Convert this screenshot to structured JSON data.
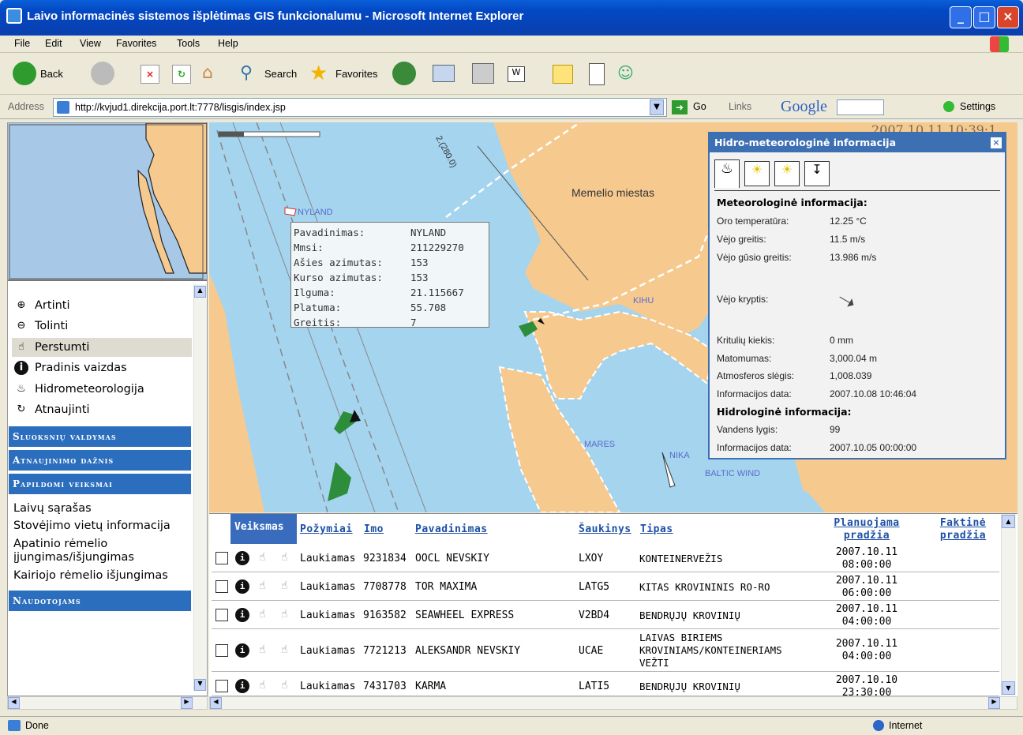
{
  "window": {
    "title": "Laivo informacinės sistemos išplėtimas GIS funkcionalumu - Microsoft Internet Explorer"
  },
  "menu": [
    "File",
    "Edit",
    "View",
    "Favorites",
    "Tools",
    "Help"
  ],
  "toolbar": {
    "back": "Back",
    "search": "Search",
    "favorites": "Favorites"
  },
  "address": {
    "label": "Address",
    "url": "http://kvjud1.direkcija.port.lt:7778/lisgis/index.jsp",
    "go": "Go",
    "links": "Links",
    "google": "Google",
    "settings": "Settings"
  },
  "tools": [
    {
      "label": "Artinti",
      "icon": "zoom-in-icon"
    },
    {
      "label": "Tolinti",
      "icon": "zoom-out-icon"
    },
    {
      "label": "Perstumti",
      "icon": "pan-hand-icon"
    },
    {
      "label": "Pradinis vaizdas",
      "icon": "info-icon"
    },
    {
      "label": "Hidrometeorologija",
      "icon": "hydro-icon"
    },
    {
      "label": "Atnaujinti",
      "icon": "refresh-icon"
    }
  ],
  "sections": {
    "layers": "Sluoksnių valdymas",
    "refresh_rate": "Atnaujinimo dažnis",
    "extra": "Papildomi veiksmai",
    "users": "Naudotojams"
  },
  "extra_links": [
    "Laivų sąrašas",
    "Stovėjimo vietų informacija",
    "Apatinio rėmelio įjungimas/išjungimas",
    "Kairiojo rėmelio išjungimas"
  ],
  "map": {
    "timestamp": "2007.10.11 10:39:1",
    "city_label": "Memelio miestas",
    "ship_labels": [
      "NYLAND",
      "KIHU",
      "MARES",
      "NIKA",
      "BALTIC WIND"
    ],
    "route_label": "2.(280.0)"
  },
  "ship_popup": {
    "rows": [
      {
        "k": "Pavadinimas:",
        "v": "NYLAND"
      },
      {
        "k": "Mmsi:",
        "v": "211229270"
      },
      {
        "k": "Ašies azimutas:",
        "v": "153"
      },
      {
        "k": "Kurso azimutas:",
        "v": "153"
      },
      {
        "k": "Ilguma:",
        "v": "21.115667"
      },
      {
        "k": "Platuma:",
        "v": "55.708"
      },
      {
        "k": "Greitis:",
        "v": "7"
      }
    ]
  },
  "hydro": {
    "title": "Hidro-meteorologinė informacija",
    "meteo_header": "Meteorologinė informacija:",
    "hydro_header": "Hidrologinė informacija:",
    "meteo": [
      {
        "k": "Oro temperatūra:",
        "v": "12.25 °C"
      },
      {
        "k": "Vėjo greitis:",
        "v": "11.5 m/s"
      },
      {
        "k": "Vėjo gūsio greitis:",
        "v": "13.986 m/s"
      },
      {
        "k": "Vėjo kryptis:",
        "v": ""
      },
      {
        "k": "Kritulių kiekis:",
        "v": "0 mm"
      },
      {
        "k": "Matomumas:",
        "v": "3,000.04 m"
      },
      {
        "k": "Atmosferos slėgis:",
        "v": "1,008.039"
      },
      {
        "k": "Informacijos data:",
        "v": "2007.10.08 10:46:04"
      }
    ],
    "hydrology": [
      {
        "k": "Vandens lygis:",
        "v": "99"
      },
      {
        "k": "Informacijos data:",
        "v": "2007.10.05 00:00:00"
      }
    ]
  },
  "table": {
    "headers": {
      "action": "Veiksmas",
      "features": "Požymiai",
      "imo": "Imo",
      "name": "Pavadinimas",
      "callsign": "Šaukinys",
      "type": "Tipas",
      "planned": "Planuojama pradžia",
      "actual": "Faktinė pradžia"
    },
    "rows": [
      {
        "feature": "Laukiamas",
        "imo": "9231834",
        "name": "OOCL NEVSKIY",
        "callsign": "LXOY",
        "type": "KONTEINERVEŽIS",
        "planned_date": "2007.10.11",
        "planned_time": "08:00:00"
      },
      {
        "feature": "Laukiamas",
        "imo": "7708778",
        "name": "TOR MAXIMA",
        "callsign": "LATG5",
        "type": "KITAS KROVININIS RO-RO",
        "planned_date": "2007.10.11",
        "planned_time": "06:00:00"
      },
      {
        "feature": "Laukiamas",
        "imo": "9163582",
        "name": "SEAWHEEL EXPRESS",
        "callsign": "V2BD4",
        "type": "BENDRŲJŲ KROVINIŲ",
        "planned_date": "2007.10.11",
        "planned_time": "04:00:00"
      },
      {
        "feature": "Laukiamas",
        "imo": "7721213",
        "name": "ALEKSANDR NEVSKIY",
        "callsign": "UCAE",
        "type": "LAIVAS BIRIEMS KROVINIAMS/KONTEINERIAMS VEŽTI",
        "planned_date": "2007.10.11",
        "planned_time": "04:00:00"
      },
      {
        "feature": "Laukiamas",
        "imo": "7431703",
        "name": "KARMA",
        "callsign": "LATI5",
        "type": "BENDRŲJŲ KROVINIŲ",
        "planned_date": "2007.10.10",
        "planned_time": "23:30:00"
      }
    ]
  },
  "status": {
    "left": "Done",
    "zone": "Internet"
  }
}
